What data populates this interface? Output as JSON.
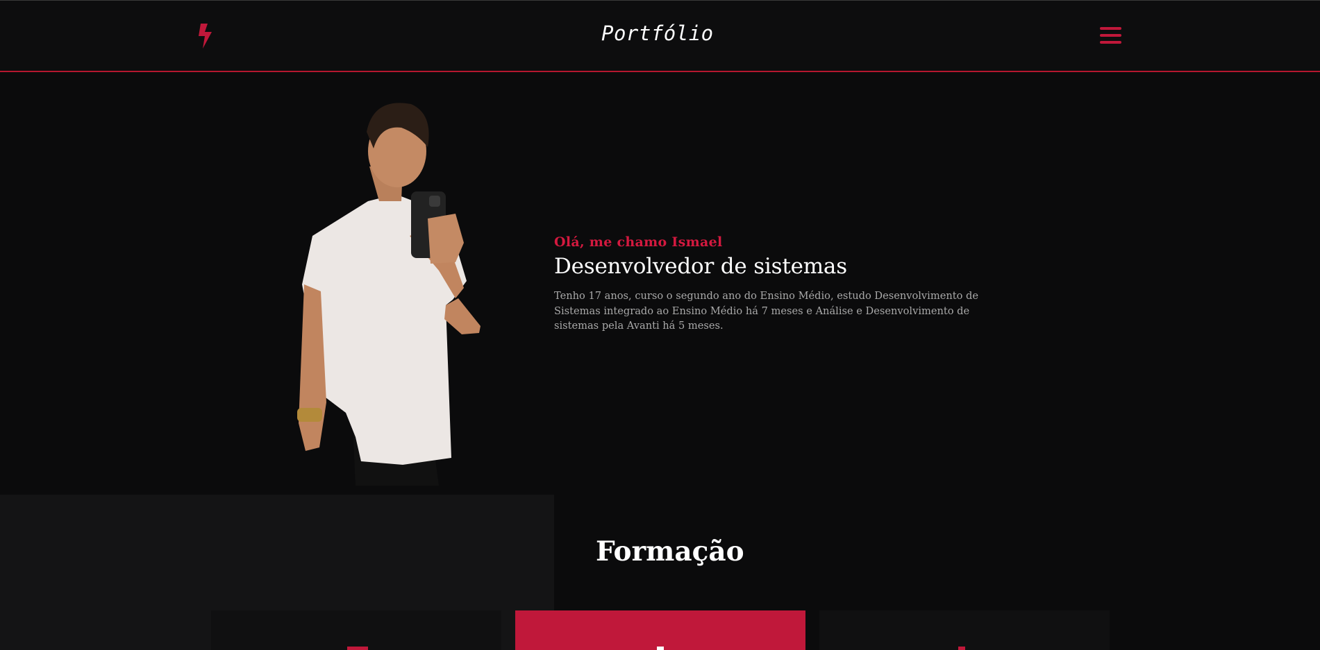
{
  "header": {
    "brand": "Portfólio",
    "logo_icon": "lightning-bolt-icon",
    "menu_icon": "hamburger-menu-icon",
    "accent_color": "#c0183a"
  },
  "hero": {
    "greeting": "Olá, me chamo Ismael",
    "role": "Desenvolvedor de sistemas",
    "bio": "Tenho 17 anos, curso o segundo ano do Ensino Médio, estudo Desenvolvimento de Sistemas integrado ao Ensino Médio há 7 meses e Análise e Desenvolvimento de sistemas pela Avanti há 5 meses."
  },
  "education": {
    "title": "Formação"
  }
}
